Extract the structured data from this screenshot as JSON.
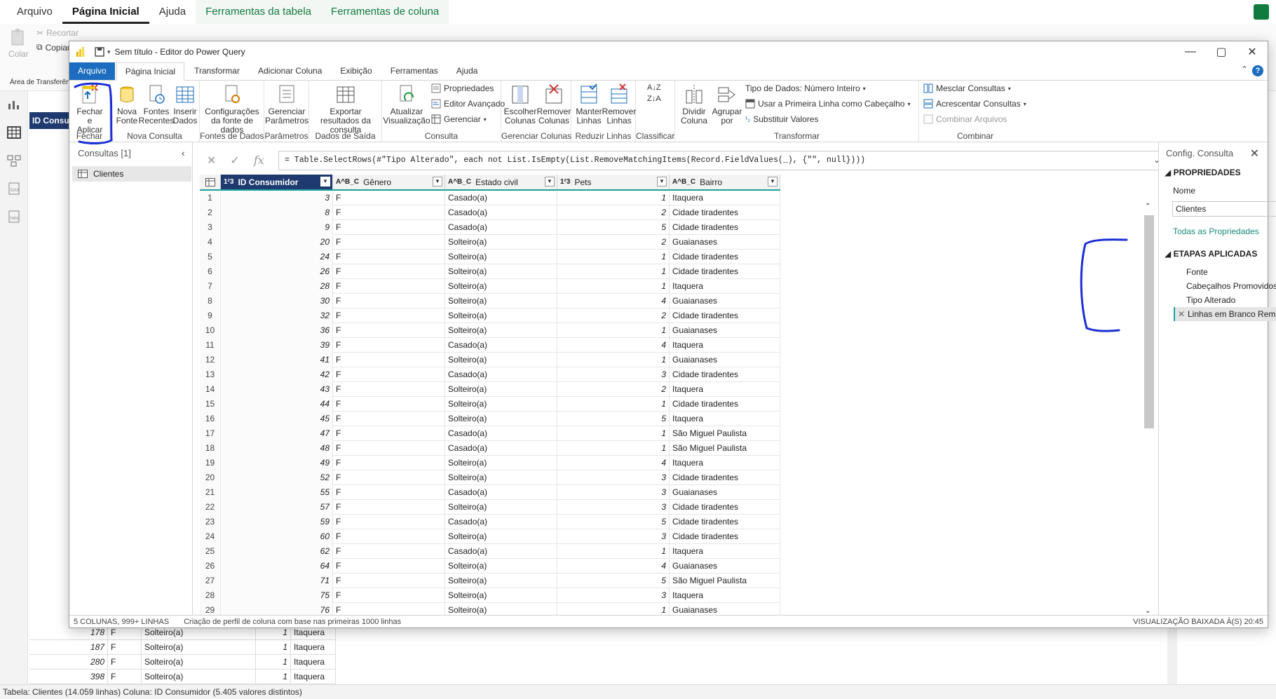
{
  "bg": {
    "tabs": [
      "Arquivo",
      "Página Inicial",
      "Ajuda",
      "Ferramentas da tabela",
      "Ferramentas de coluna"
    ],
    "ribbon": {
      "cut": "Recortar",
      "copy": "Copiar",
      "paste": "Colar",
      "clipboard": "Área de Transferência"
    },
    "grid_header": "ID Consumidor",
    "rows": [
      {
        "id": "178",
        "g": "F",
        "e": "Solteiro(a)",
        "p": "1",
        "b": "Itaquera"
      },
      {
        "id": "187",
        "g": "F",
        "e": "Solteiro(a)",
        "p": "1",
        "b": "Itaquera"
      },
      {
        "id": "280",
        "g": "F",
        "e": "Solteiro(a)",
        "p": "1",
        "b": "Itaquera"
      },
      {
        "id": "398",
        "g": "F",
        "e": "Solteiro(a)",
        "p": "1",
        "b": "Itaquera"
      }
    ],
    "status": "Tabela: Clientes (14.059 linhas) Coluna: ID Consumidor (5.405 valores distintos)"
  },
  "window": {
    "title": "Sem título - Editor do Power Query",
    "tabs": [
      "Arquivo",
      "Página Inicial",
      "Transformar",
      "Adicionar Coluna",
      "Exibição",
      "Ferramentas",
      "Ajuda"
    ],
    "help": "?"
  },
  "ribbon": {
    "close_apply": "Fechar e Aplicar",
    "new_source": "Nova Fonte",
    "recent_sources": "Fontes Recentes",
    "enter_data": "Inserir Dados",
    "ds_settings": "Configurações da fonte de dados",
    "manage_params": "Gerenciar Parâmetros",
    "export": "Exportar resultados da consulta",
    "refresh": "Atualizar Visualização",
    "properties": "Propriedades",
    "adv_editor": "Editor Avançado",
    "manage": "Gerenciar",
    "choose_cols": "Escolher Colunas",
    "remove_cols": "Remover Colunas",
    "keep_rows": "Manter Linhas",
    "remove_rows": "Remover Linhas",
    "split_col": "Dividir Coluna",
    "group_by": "Agrupar por",
    "data_type": "Tipo de Dados: Número Inteiro",
    "first_row": "Usar a Primeira Linha como Cabeçalho",
    "replace": "Substituir Valores",
    "merge": "Mesclar Consultas",
    "append": "Acrescentar Consultas",
    "combine": "Combinar Arquivos",
    "groups": {
      "close": "Fechar",
      "new_query": "Nova Consulta",
      "data_sources": "Fontes de Dados",
      "params": "Parâmetros",
      "output": "Dados de Saída",
      "query": "Consulta",
      "manage_cols": "Gerenciar Colunas",
      "reduce_rows": "Reduzir Linhas",
      "sort": "Classificar",
      "transform": "Transformar",
      "combine": "Combinar"
    }
  },
  "queries": {
    "header": "Consultas [1]",
    "items": [
      "Clientes"
    ]
  },
  "formula": "= Table.SelectRows(#\"Tipo Alterado\", each not List.IsEmpty(List.RemoveMatchingItems(Record.FieldValues(_), {\"\", null})))",
  "columns": [
    {
      "type": "1²3",
      "name": "ID Consumidor"
    },
    {
      "type": "A^B_C",
      "name": "Gênero"
    },
    {
      "type": "A^B_C",
      "name": "Estado civil"
    },
    {
      "type": "1²3",
      "name": "Pets"
    },
    {
      "type": "A^B_C",
      "name": "Bairro"
    }
  ],
  "rows": [
    [
      "1",
      "3",
      "F",
      "Casado(a)",
      "1",
      "Itaquera"
    ],
    [
      "2",
      "8",
      "F",
      "Casado(a)",
      "2",
      "Cidade tiradentes"
    ],
    [
      "3",
      "9",
      "F",
      "Casado(a)",
      "5",
      "Cidade tiradentes"
    ],
    [
      "4",
      "20",
      "F",
      "Solteiro(a)",
      "2",
      "Guaianases"
    ],
    [
      "5",
      "24",
      "F",
      "Solteiro(a)",
      "1",
      "Cidade tiradentes"
    ],
    [
      "6",
      "26",
      "F",
      "Solteiro(a)",
      "1",
      "Cidade tiradentes"
    ],
    [
      "7",
      "28",
      "F",
      "Solteiro(a)",
      "1",
      "Itaquera"
    ],
    [
      "8",
      "30",
      "F",
      "Solteiro(a)",
      "4",
      "Guaianases"
    ],
    [
      "9",
      "32",
      "F",
      "Solteiro(a)",
      "2",
      "Cidade tiradentes"
    ],
    [
      "10",
      "36",
      "F",
      "Solteiro(a)",
      "1",
      "Guaianases"
    ],
    [
      "11",
      "39",
      "F",
      "Casado(a)",
      "4",
      "Itaquera"
    ],
    [
      "12",
      "41",
      "F",
      "Solteiro(a)",
      "1",
      "Guaianases"
    ],
    [
      "13",
      "42",
      "F",
      "Casado(a)",
      "3",
      "Cidade tiradentes"
    ],
    [
      "14",
      "43",
      "F",
      "Solteiro(a)",
      "2",
      "Itaquera"
    ],
    [
      "15",
      "44",
      "F",
      "Solteiro(a)",
      "1",
      "Cidade tiradentes"
    ],
    [
      "16",
      "45",
      "F",
      "Solteiro(a)",
      "5",
      "Itaquera"
    ],
    [
      "17",
      "47",
      "F",
      "Casado(a)",
      "1",
      "São Miguel Paulista"
    ],
    [
      "18",
      "48",
      "F",
      "Casado(a)",
      "1",
      "São Miguel Paulista"
    ],
    [
      "19",
      "49",
      "F",
      "Solteiro(a)",
      "4",
      "Itaquera"
    ],
    [
      "20",
      "52",
      "F",
      "Solteiro(a)",
      "3",
      "Cidade tiradentes"
    ],
    [
      "21",
      "55",
      "F",
      "Casado(a)",
      "3",
      "Guaianases"
    ],
    [
      "22",
      "57",
      "F",
      "Solteiro(a)",
      "3",
      "Cidade tiradentes"
    ],
    [
      "23",
      "59",
      "F",
      "Casado(a)",
      "5",
      "Cidade tiradentes"
    ],
    [
      "24",
      "60",
      "F",
      "Solteiro(a)",
      "3",
      "Cidade tiradentes"
    ],
    [
      "25",
      "62",
      "F",
      "Casado(a)",
      "1",
      "Itaquera"
    ],
    [
      "26",
      "64",
      "F",
      "Solteiro(a)",
      "4",
      "Guaianases"
    ],
    [
      "27",
      "71",
      "F",
      "Solteiro(a)",
      "5",
      "São Miguel Paulista"
    ],
    [
      "28",
      "75",
      "F",
      "Solteiro(a)",
      "3",
      "Itaquera"
    ],
    [
      "29",
      "76",
      "F",
      "Solteiro(a)",
      "1",
      "Guaianases"
    ]
  ],
  "settings": {
    "title": "Config. Consulta",
    "props_header": "PROPRIEDADES",
    "name_label": "Nome",
    "name_value": "Clientes",
    "all_props": "Todas as Propriedades",
    "steps_header": "ETAPAS APLICADAS",
    "steps": [
      "Fonte",
      "Cabeçalhos Promovidos",
      "Tipo Alterado",
      "Linhas em Branco Removidas"
    ]
  },
  "status": {
    "left": "5 COLUNAS, 999+ LINHAS",
    "middle": "Criação de perfil de coluna com base nas primeiras 1000 linhas",
    "right": "VISUALIZAÇÃO BAIXADA À(S) 20:45"
  },
  "colors": {
    "accent": "#1c6dbf",
    "header": "#1f3a6e",
    "teal": "#1aa1a0",
    "annotation": "#1b2fd4"
  }
}
